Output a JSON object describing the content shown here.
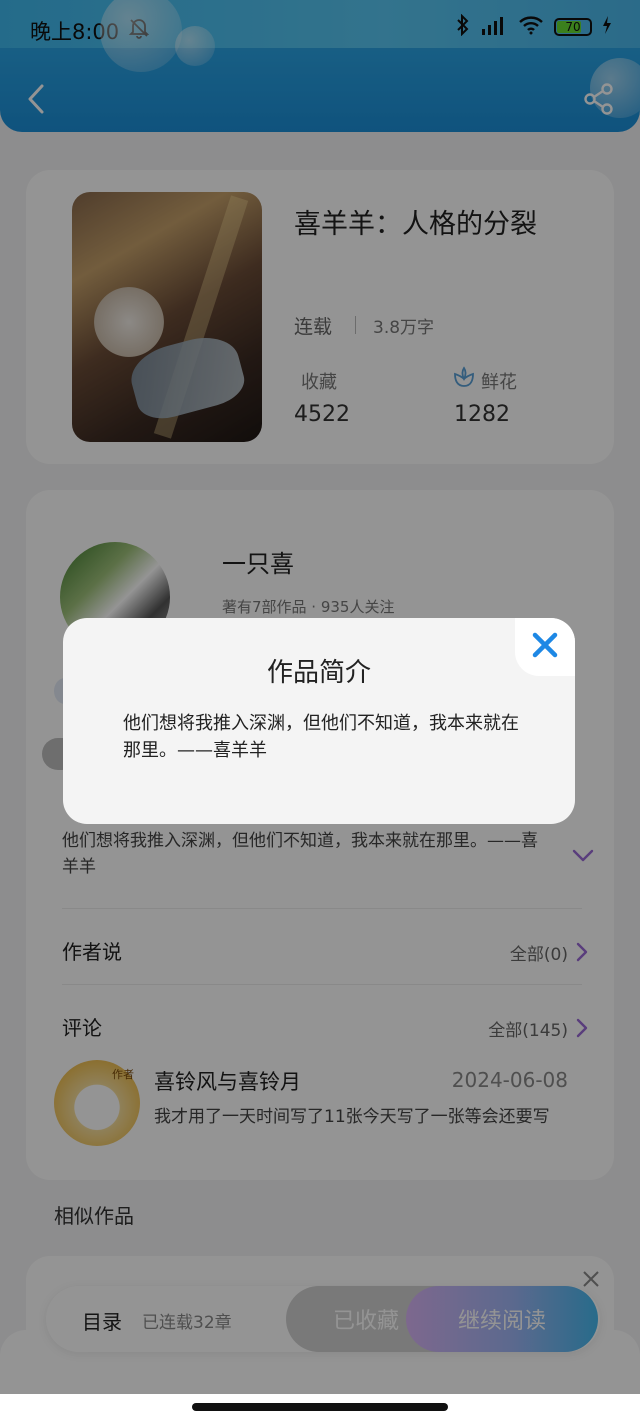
{
  "status_bar": {
    "time": "晚上8:00",
    "battery": "70",
    "icons": [
      "bell-muted-icon",
      "bluetooth-icon",
      "signal-hd-icon",
      "wifi-icon",
      "battery-icon",
      "charging-icon"
    ]
  },
  "header": {
    "back_icon": "back-icon",
    "share_icon": "share-icon"
  },
  "book": {
    "title": "喜羊羊：人格的分裂",
    "status": "连载",
    "words": "3.8万字",
    "favorites_label": "收藏",
    "favorites_value": "4522",
    "flowers_label": "鲜花",
    "flowers_value": "1282"
  },
  "author": {
    "name": "一只喜",
    "meta": "著有7部作品 · 935人关注"
  },
  "intro": {
    "text": "他们想将我推入深渊，但他们不知道，我本来就在那里。——喜羊羊"
  },
  "author_says": {
    "label": "作者说",
    "link": "全部(0)"
  },
  "comments": {
    "label": "评论",
    "link": "全部(145)",
    "items": [
      {
        "avatar_tag": "作者",
        "name": "喜铃风与喜铃月",
        "date": "2024-06-08",
        "text": "我才用了一天时间写了11张今天写了一张等会还要写"
      }
    ]
  },
  "similar": {
    "label": "相似作品"
  },
  "bottom_bar": {
    "toc": "目录",
    "chapters": "已连载32章",
    "collected": "已收藏",
    "continue": "继续阅读"
  },
  "modal": {
    "title": "作品简介",
    "body": "他们想将我推入深渊，但他们不知道，我本来就在那里。——喜羊羊"
  },
  "colors": {
    "accent_blue": "#1b8fd8",
    "close_blue": "#1e88e5",
    "chevron_purple": "#9a6ad6"
  }
}
